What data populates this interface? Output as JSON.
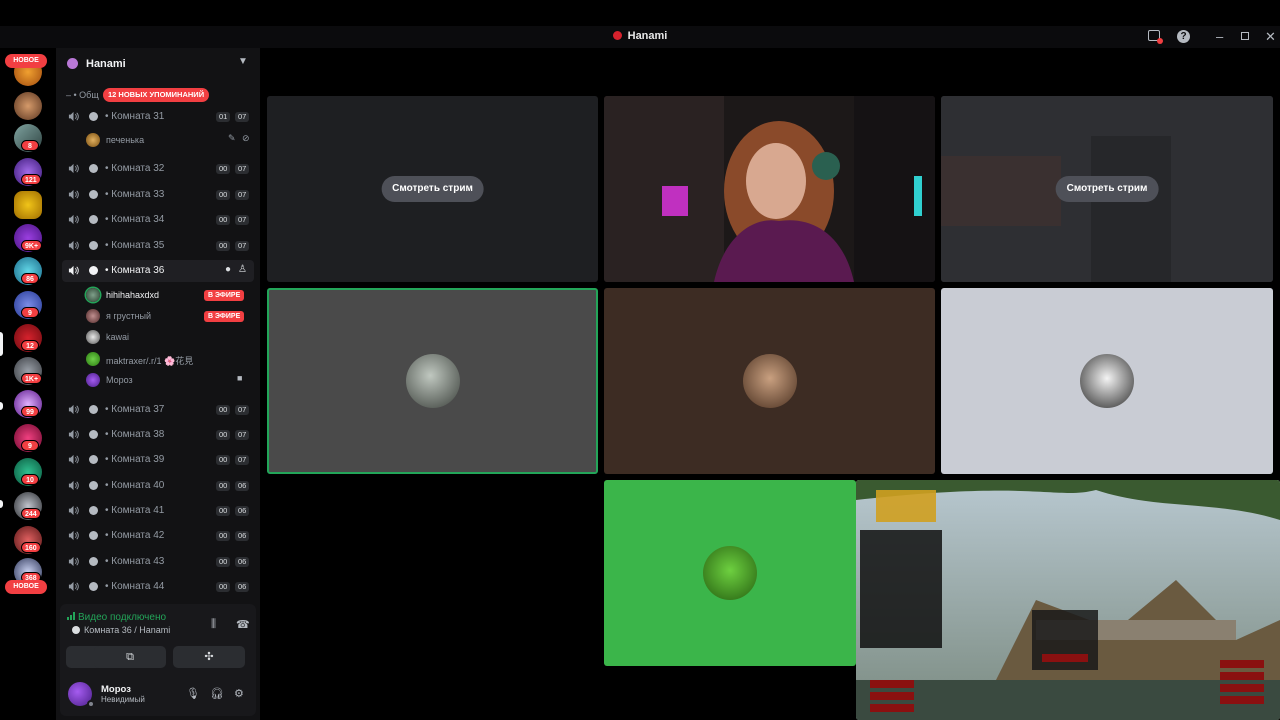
{
  "window": {
    "title": "Hanami",
    "controls": [
      "minimize-icon",
      "maximize-icon",
      "close-icon"
    ]
  },
  "rail": {
    "new_top_label": "НОВОЕ",
    "new_bottom_label": "НОВОЕ",
    "badges": [
      "8",
      "121",
      "9K+",
      "86",
      "9",
      "12",
      "1K+",
      "99",
      "9",
      "10",
      "244",
      "160",
      "368"
    ]
  },
  "guild": {
    "name": "Hanami",
    "category": "– • Общ",
    "mentions_label": "12 НОВЫХ УПОМИНАНИЙ"
  },
  "channels": [
    {
      "name": "• Комната 31",
      "a": "01",
      "b": "07"
    },
    {
      "name": "• Комната 32",
      "a": "00",
      "b": "07"
    },
    {
      "name": "• Комната 33",
      "a": "00",
      "b": "07"
    },
    {
      "name": "• Комната 34",
      "a": "00",
      "b": "07"
    },
    {
      "name": "• Комната 35",
      "a": "00",
      "b": "07"
    },
    {
      "name": "• Комната 36"
    },
    {
      "name": "• Комната 37",
      "a": "00",
      "b": "07"
    },
    {
      "name": "• Комната 38",
      "a": "00",
      "b": "07"
    },
    {
      "name": "• Комната 39",
      "a": "00",
      "b": "07"
    },
    {
      "name": "• Комната 40",
      "a": "00",
      "b": "06"
    },
    {
      "name": "• Комната 41",
      "a": "00",
      "b": "06"
    },
    {
      "name": "• Комната 42",
      "a": "00",
      "b": "06"
    },
    {
      "name": "• Комната 43",
      "a": "00",
      "b": "06"
    },
    {
      "name": "• Комната 44",
      "a": "00",
      "b": "06"
    }
  ],
  "room31_member": {
    "name": "печенька"
  },
  "room36_members": [
    {
      "name": "hihihahaxdxd",
      "live": "В ЭФИРЕ"
    },
    {
      "name": "я грустный",
      "live": "В ЭФИРЕ"
    },
    {
      "name": "kawai"
    },
    {
      "name": "maktraxer/.r/1 🌸花見"
    },
    {
      "name": "Мороз"
    }
  ],
  "voice": {
    "status": "Видео подключено",
    "channel": "Комната 36 / Hanami"
  },
  "user": {
    "name": "Мороз",
    "status": "Невидимый"
  },
  "stage": {
    "watch_label_1": "Смотреть стрим",
    "watch_label_2": "Смотреть стрим"
  },
  "colors": {
    "accent_green": "#23a559",
    "danger_red": "#f23f42",
    "sidebar_bg": "#121214",
    "tile_bg": "#1e1f22"
  }
}
